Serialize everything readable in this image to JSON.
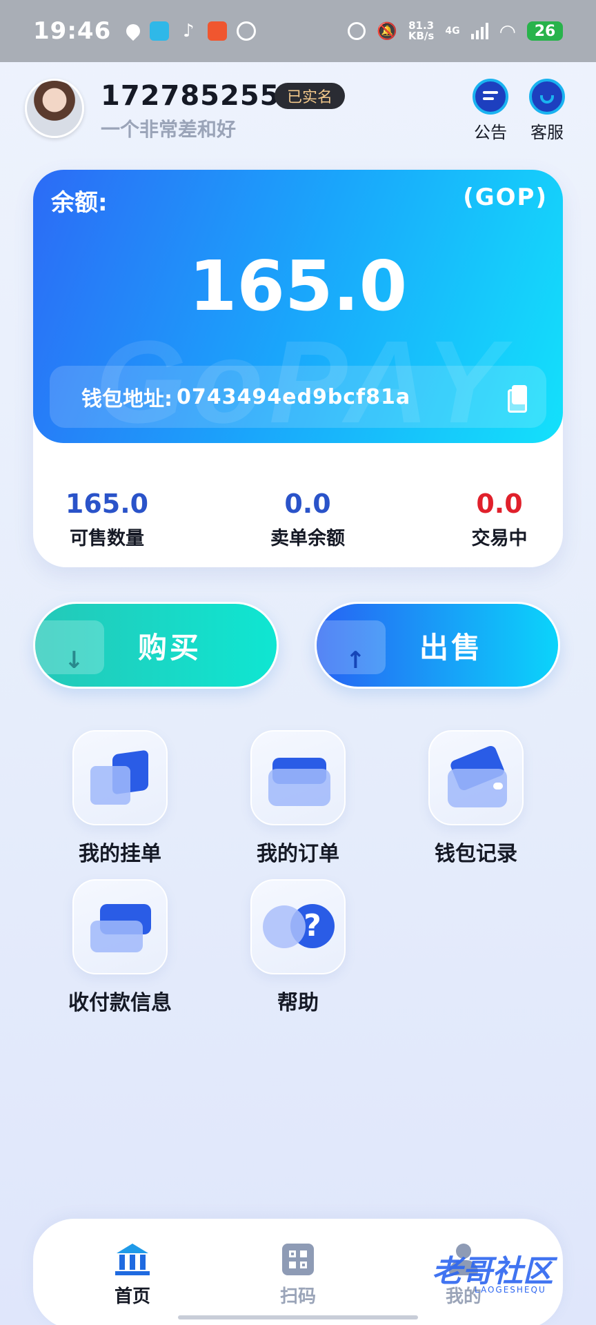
{
  "status_bar": {
    "time": "19:46",
    "net_speed": "81.3",
    "net_unit": "KB/s",
    "net_type": "4G",
    "battery": "26"
  },
  "header": {
    "phone": "17278525591",
    "verified_badge": "已实名",
    "motto": "一个非常差和好",
    "notice_label": "公告",
    "service_label": "客服"
  },
  "balance": {
    "label": "余额:",
    "unit": "(GOP)",
    "value": "165.0",
    "watermark": "GoPAY",
    "wallet_label": "钱包地址:",
    "wallet_address": "0743494ed9bcf81a"
  },
  "stats": [
    {
      "value": "165.0",
      "label": "可售数量"
    },
    {
      "value": "0.0",
      "label": "卖单余额"
    },
    {
      "value": "0.0",
      "label": "交易中"
    }
  ],
  "actions": {
    "buy": "购买",
    "sell": "出售"
  },
  "menu": [
    {
      "label": "我的挂单",
      "icon": "listing-icon"
    },
    {
      "label": "我的订单",
      "icon": "order-folder-icon"
    },
    {
      "label": "钱包记录",
      "icon": "wallet-icon"
    },
    {
      "label": "收付款信息",
      "icon": "payment-card-icon"
    },
    {
      "label": "帮助",
      "icon": "help-icon"
    }
  ],
  "bottom_nav": [
    {
      "label": "首页",
      "icon": "home-icon",
      "active": true
    },
    {
      "label": "扫码",
      "icon": "qr-scan-icon",
      "active": false
    },
    {
      "label": "我的",
      "icon": "profile-icon",
      "active": false
    }
  ],
  "watermark_logo": {
    "text": "老哥社区",
    "sub": "LAOGESHEQU"
  },
  "colors": {
    "accent_blue": "#2a53c9",
    "red": "#e0202b",
    "buy_gradient": "#24c8b8",
    "sell_gradient": "#2763f3"
  }
}
